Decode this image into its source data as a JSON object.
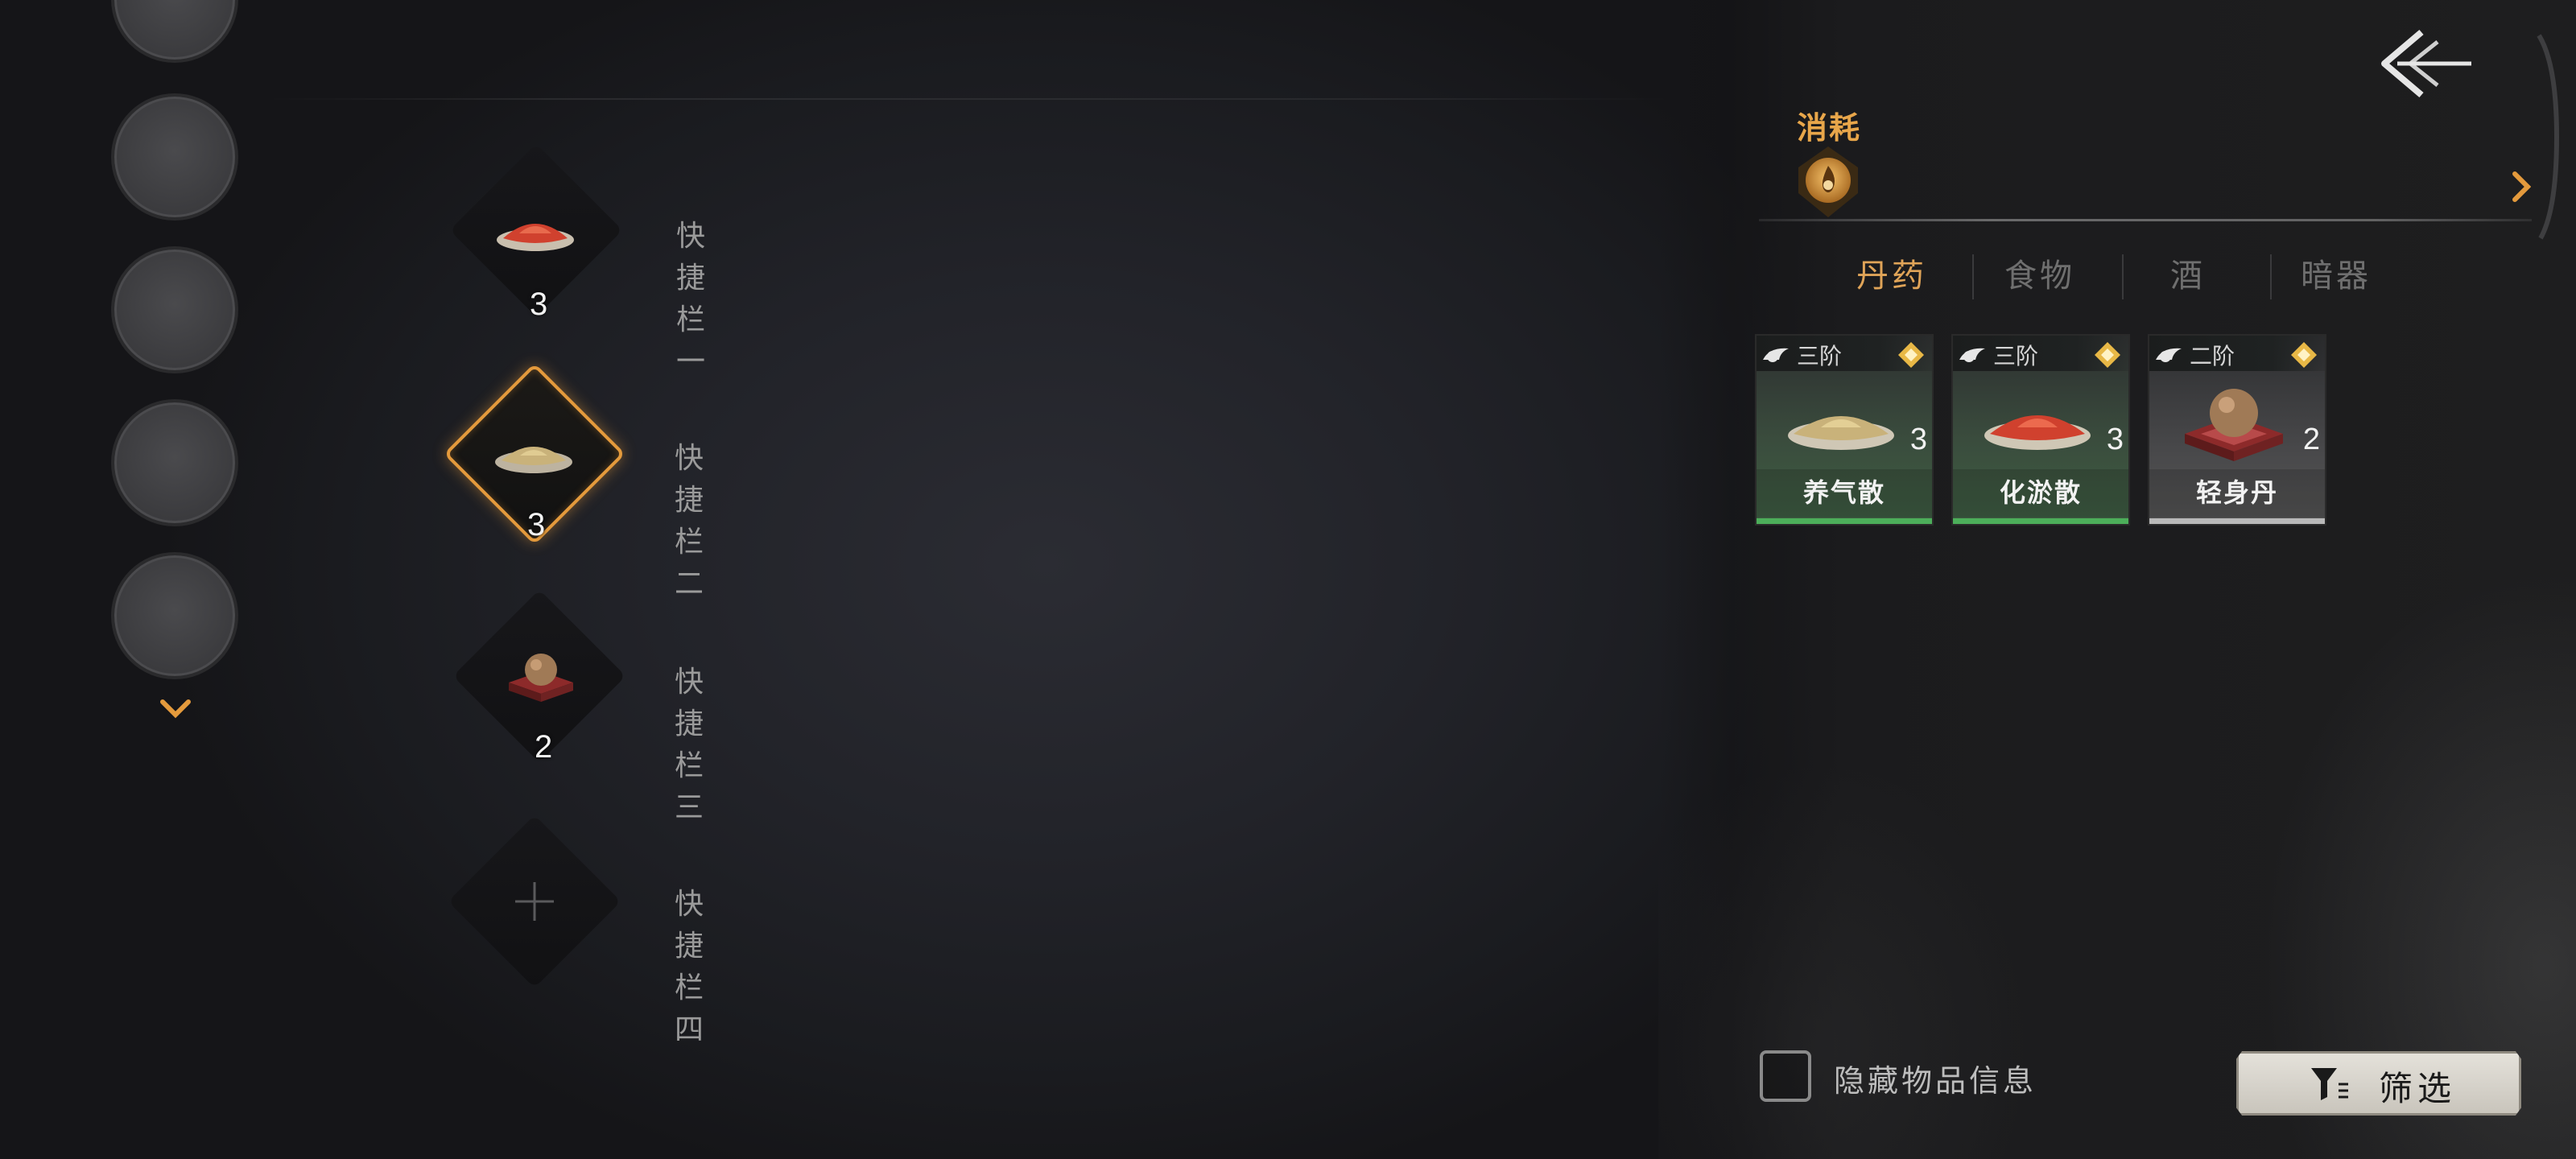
{
  "left_nav": {
    "circle_count": 5
  },
  "quick_slots": [
    {
      "label": "快捷栏一",
      "count": "3",
      "item": "red-powder"
    },
    {
      "label": "快捷栏二",
      "count": "3",
      "item": "yellow-powder",
      "selected": true
    },
    {
      "label": "快捷栏三",
      "count": "2",
      "item": "pill-on-box"
    },
    {
      "label": "快捷栏四",
      "count": "",
      "item": "empty"
    }
  ],
  "panel": {
    "category_title": "消耗",
    "tabs": [
      "丹药",
      "食物",
      "酒",
      "暗器"
    ],
    "active_tab": 0,
    "items": [
      {
        "tier": "三阶",
        "name": "养气散",
        "count": "3",
        "icon": "yellow-powder"
      },
      {
        "tier": "三阶",
        "name": "化淤散",
        "count": "3",
        "icon": "red-powder"
      },
      {
        "tier": "二阶",
        "name": "轻身丹",
        "count": "2",
        "icon": "pill-on-box"
      }
    ],
    "hide_info_label": "隐藏物品信息",
    "filter_label": "筛选"
  },
  "colors": {
    "accent": "#e0a458",
    "selected_border": "#e49a3c",
    "rarity_green": "#4cae5a",
    "rarity_grey": "#b9b9b9"
  }
}
